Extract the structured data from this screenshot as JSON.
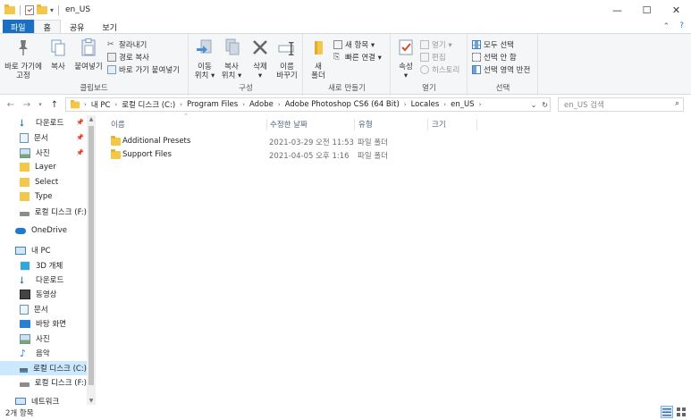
{
  "window": {
    "title": "en_US",
    "minimize": "—",
    "maximize": "☐",
    "close": "✕"
  },
  "ribbon_tabs": [
    "파일",
    "홈",
    "공유",
    "보기"
  ],
  "ribbon": {
    "clipboard": {
      "pin_label_1": "바로 가기에",
      "pin_label_2": "고정",
      "copy": "복사",
      "paste": "붙여넣기",
      "cut": "잘라내기",
      "copy_path": "경로 복사",
      "paste_shortcut": "바로 가기 붙여넣기",
      "group": "클립보드"
    },
    "organize": {
      "move_to_1": "이동",
      "move_to_2": "위치 ▾",
      "copy_to_1": "복사",
      "copy_to_2": "위치 ▾",
      "delete_1": "삭제",
      "delete_2": "▾",
      "rename_1": "이름",
      "rename_2": "바꾸기",
      "group": "구성"
    },
    "new": {
      "new_folder_1": "새",
      "new_folder_2": "폴더",
      "new_item": "새 항목 ▾",
      "easy_access": "빠른 연결 ▾",
      "group": "새로 만들기"
    },
    "open": {
      "properties_1": "속성",
      "properties_2": "▾",
      "open": "열기 ▾",
      "edit": "편집",
      "history": "히스토리",
      "group": "열기"
    },
    "select": {
      "select_all": "모두 선택",
      "select_none": "선택 안 함",
      "invert": "선택 영역 반전",
      "group": "선택"
    }
  },
  "address": {
    "crumbs": [
      "내 PC",
      "로컬 디스크 (C:)",
      "Program Files",
      "Adobe",
      "Adobe Photoshop CS6 (64 Bit)",
      "Locales",
      "en_US"
    ]
  },
  "search": {
    "placeholder": "en_US 검색"
  },
  "nav_pane": {
    "quick_access": [
      {
        "label": "다운로드",
        "pinned": true
      },
      {
        "label": "문서",
        "pinned": true
      },
      {
        "label": "사진",
        "pinned": true
      },
      {
        "label": "Layer",
        "pinned": false
      },
      {
        "label": "Select",
        "pinned": false
      },
      {
        "label": "Type",
        "pinned": false
      },
      {
        "label": "로컬 디스크 (F:)",
        "pinned": false
      }
    ],
    "onedrive": "OneDrive",
    "this_pc": "내 PC",
    "pc_items": [
      "3D 개체",
      "다운로드",
      "동영상",
      "문서",
      "바탕 화면",
      "사진",
      "음악",
      "로컬 디스크 (C:)",
      "로컬 디스크 (F:)"
    ],
    "network": "네트워크"
  },
  "columns": {
    "name": "이름",
    "date": "수정한 날짜",
    "type": "유형",
    "size": "크기"
  },
  "files": [
    {
      "name": "Additional Presets",
      "date": "2021-03-29 오전 11:53",
      "type": "파일 폴더"
    },
    {
      "name": "Support Files",
      "date": "2021-04-05 오후 1:16",
      "type": "파일 폴더"
    }
  ],
  "status": {
    "count": "2개 항목"
  },
  "colors": {
    "accent": "#1a6fc3",
    "selected_bg": "#cce8ff",
    "folder": "#f3c84a"
  }
}
